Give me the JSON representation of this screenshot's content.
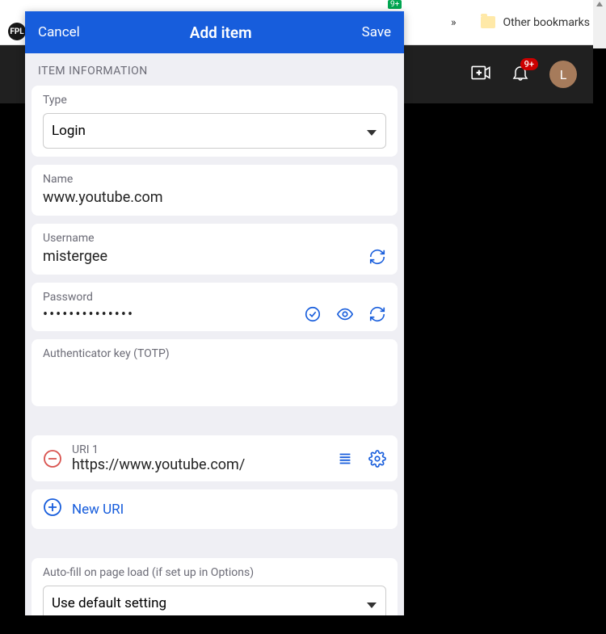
{
  "browser": {
    "other_bookmarks": "Other bookmarks",
    "fpl_label": "FPL",
    "tiny_badge": "9+"
  },
  "yt": {
    "badge": "9+",
    "avatar_letter": "L"
  },
  "panel": {
    "cancel": "Cancel",
    "title": "Add item",
    "save": "Save"
  },
  "section": {
    "header": "ITEM INFORMATION"
  },
  "fields": {
    "type_label": "Type",
    "type_value": "Login",
    "name_label": "Name",
    "name_value": "www.youtube.com",
    "username_label": "Username",
    "username_value": "mistergee",
    "password_label": "Password",
    "password_mask": "••••••••••••••",
    "totp_label": "Authenticator key (TOTP)",
    "totp_value": ""
  },
  "uri": {
    "label": "URI 1",
    "value": "https://www.youtube.com/",
    "new_label": "New URI"
  },
  "autofill": {
    "label": "Auto-fill on page load (if set up in Options)",
    "value": "Use default setting"
  }
}
